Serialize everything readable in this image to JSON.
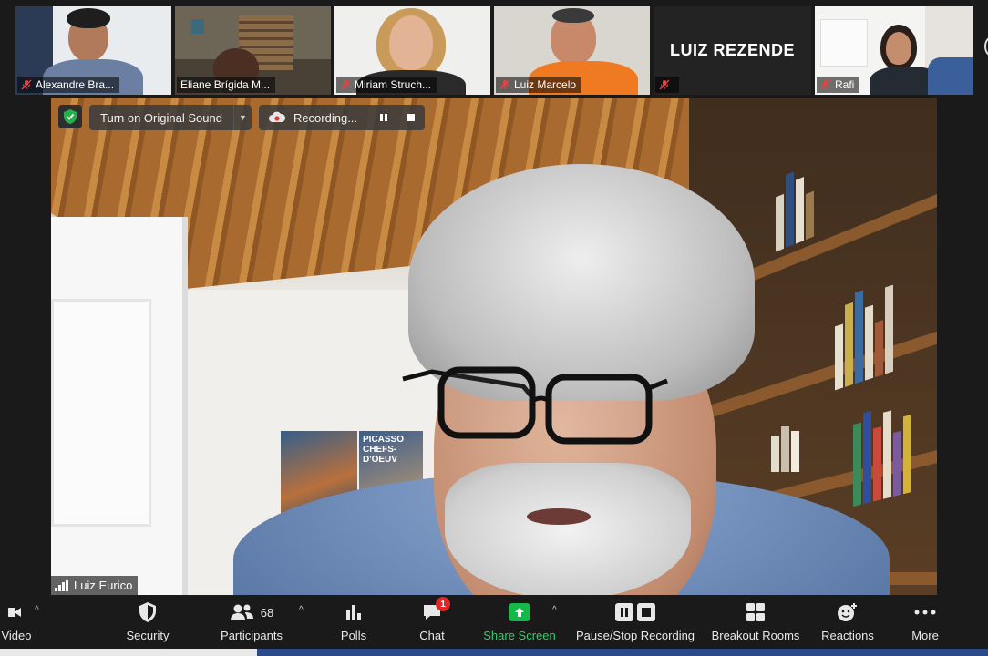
{
  "participants": [
    {
      "name": "Alexandre Bra...",
      "muted": true
    },
    {
      "name": "Eliane Brígida M...",
      "muted": false
    },
    {
      "name": "Miriam Struch...",
      "muted": true
    },
    {
      "name": "Luiz Marcelo",
      "muted": true
    },
    {
      "name": "",
      "display_name": "LUIZ REZENDE",
      "muted": true
    },
    {
      "name": "Rafi",
      "muted": true
    }
  ],
  "main_video": {
    "speaker_name": "Luiz Eurico",
    "poster_text": "PICASSO CHEFS-D'OEUV",
    "original_sound_label": "Turn on Original Sound",
    "recording_label": "Recording..."
  },
  "toolbar": {
    "video_label": "Video",
    "security_label": "Security",
    "participants_label": "Participants",
    "participants_count": "68",
    "polls_label": "Polls",
    "chat_label": "Chat",
    "chat_badge": "1",
    "share_label": "Share Screen",
    "recording_label": "Pause/Stop Recording",
    "breakout_label": "Breakout Rooms",
    "reactions_label": "Reactions",
    "more_label": "More"
  },
  "colors": {
    "background": "#1a1a1a",
    "share_green": "#15b84a",
    "badge_red": "#e02828",
    "mute_red": "#e24444"
  }
}
